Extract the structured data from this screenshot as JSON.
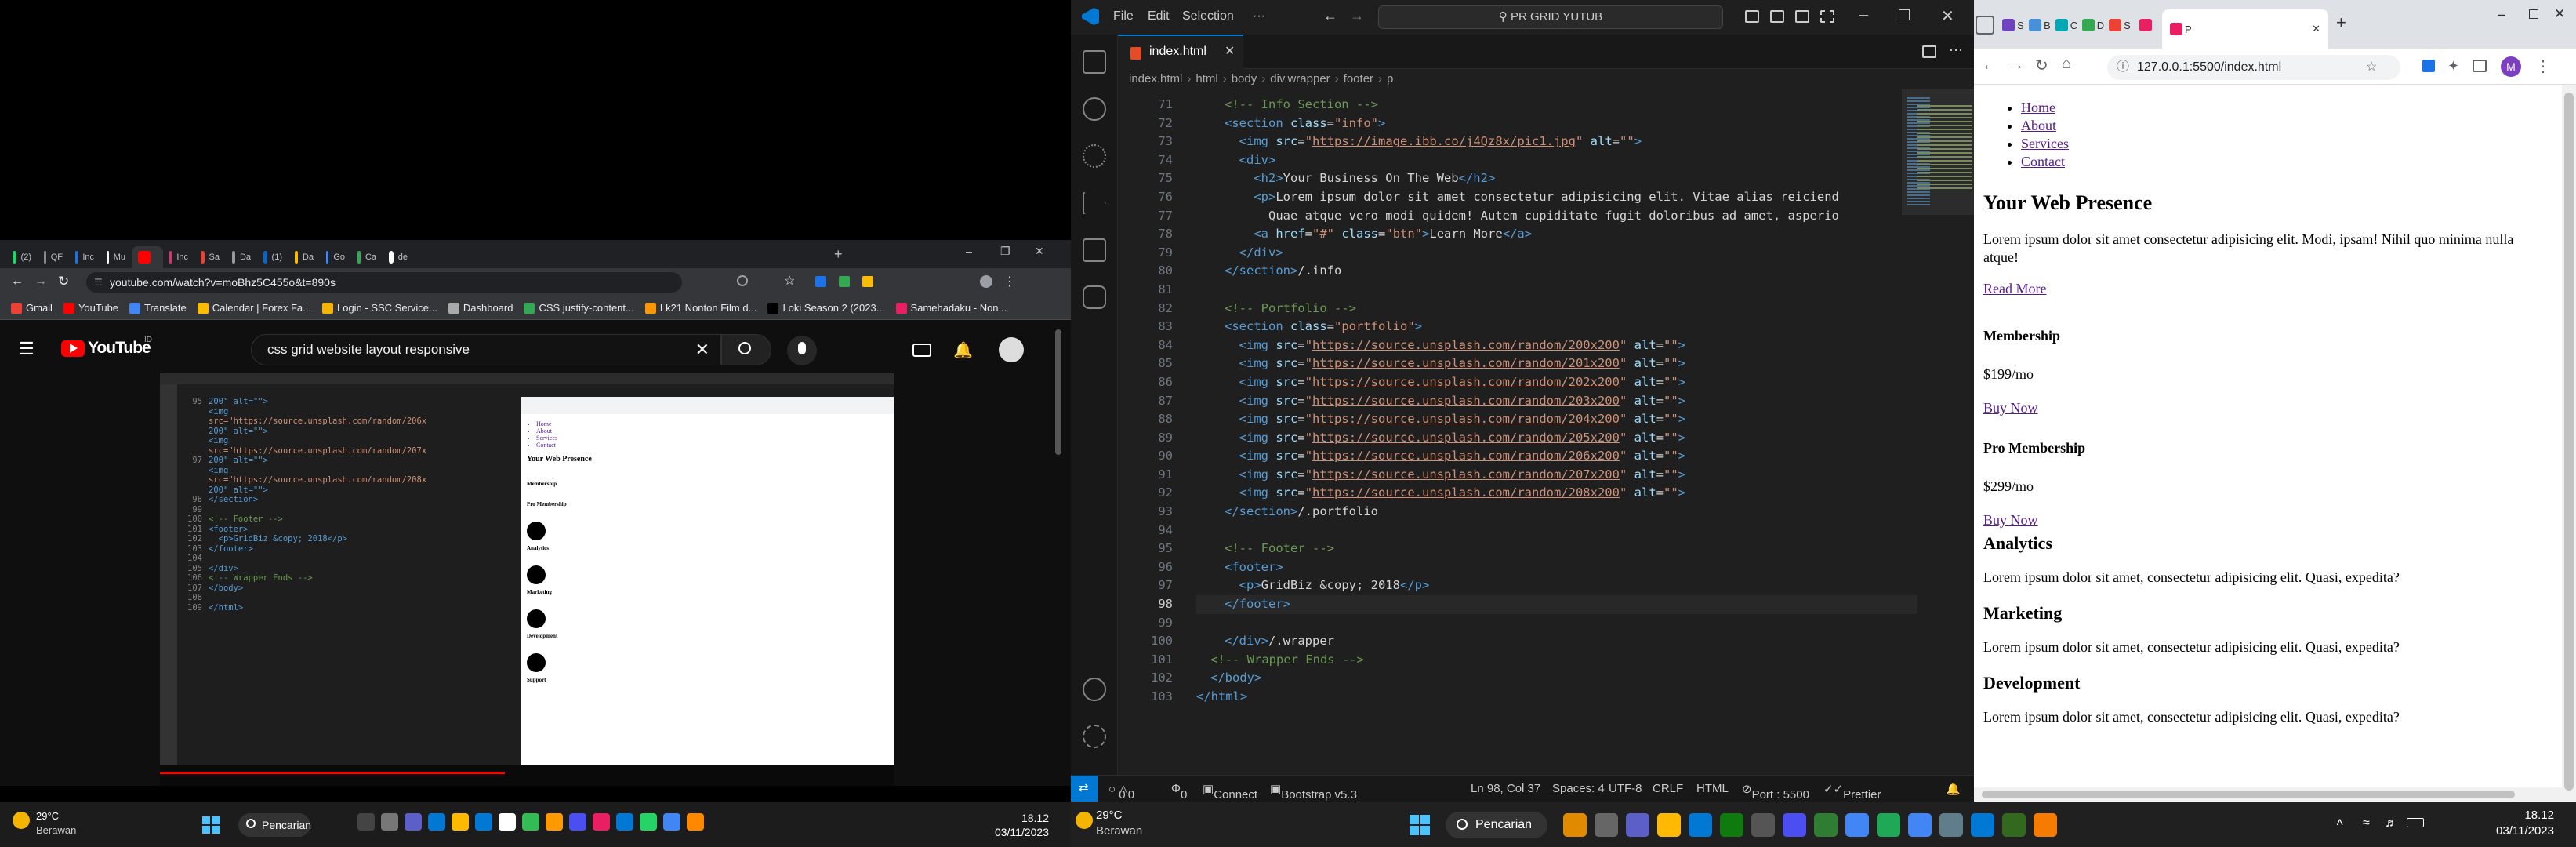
{
  "left_browser": {
    "tabs": [
      "(2)",
      "QF",
      "Inc",
      "Mu",
      "",
      "Inc",
      "Sa",
      "Da",
      "(1)",
      "Da",
      "Go",
      "Ca",
      "de"
    ],
    "url": "youtube.com/watch?v=moBhz5C455o&t=890s",
    "bookmarks": [
      "Gmail",
      "YouTube",
      "Translate",
      "Calendar | Forex Fa...",
      "Login - SSC Service...",
      "Dashboard",
      "CSS justify-content...",
      "Lk21 Nonton Film d...",
      "Loki Season 2 (2023...",
      "Samehadaku - Non..."
    ],
    "youtube": {
      "logo": "YouTube",
      "region": "ID",
      "search_value": "css grid website layout responsive"
    },
    "video": {
      "code_lines": [
        {
          "n": "95",
          "t": "200\" alt=\"\">"
        },
        {
          "n": "",
          "t": "<img"
        },
        {
          "n": "",
          "t": "src=\"https://source.unsplash.com/random/206x"
        },
        {
          "n": "",
          "t": "200\" alt=\"\">"
        },
        {
          "n": "",
          "t": "<img"
        },
        {
          "n": "",
          "t": "src=\"https://source.unsplash.com/random/207x"
        },
        {
          "n": "97",
          "t": "200\" alt=\"\">"
        },
        {
          "n": "",
          "t": "<img"
        },
        {
          "n": "",
          "t": "src=\"https://source.unsplash.com/random/208x"
        },
        {
          "n": "",
          "t": "200\" alt=\"\">"
        },
        {
          "n": "98",
          "t": "</section>"
        },
        {
          "n": "99",
          "t": ""
        },
        {
          "n": "100",
          "t": "<!-- Footer -->"
        },
        {
          "n": "101",
          "t": "<footer>"
        },
        {
          "n": "102",
          "t": "  <p>GridBiz &copy; 2018</p>"
        },
        {
          "n": "103",
          "t": "</footer>"
        },
        {
          "n": "104",
          "t": ""
        },
        {
          "n": "105",
          "t": "</div>"
        },
        {
          "n": "106",
          "t": "<!-- Wrapper Ends -->"
        },
        {
          "n": "107",
          "t": "</body>"
        },
        {
          "n": "108",
          "t": ""
        },
        {
          "n": "109",
          "t": "</html>"
        }
      ],
      "page_links": [
        "Home",
        "About",
        "Services",
        "Contact"
      ],
      "page_title": "Your Web Presence",
      "page_sections": [
        "Membership",
        "Pro Membership",
        "Analytics",
        "Marketing",
        "Development",
        "Support"
      ]
    }
  },
  "left_taskbar": {
    "weather_temp": "29°C",
    "weather_desc": "Berawan",
    "search_label": "Pencarian",
    "time": "18.12",
    "date": "03/11/2023"
  },
  "vscode": {
    "menu": [
      "File",
      "Edit",
      "Selection",
      "···"
    ],
    "command_center": "PR GRID YUTUB",
    "tab": "index.html",
    "breadcrumb": [
      "index.html",
      "html",
      "body",
      "div.wrapper",
      "footer",
      "p"
    ],
    "first_line": 71,
    "current_line": 98,
    "status": {
      "errors": "0",
      "warnings": "0",
      "ports": "0",
      "connect": "Connect",
      "bootstrap": "Bootstrap v5.3",
      "position": "Ln 98, Col 37",
      "spaces": "Spaces: 4",
      "encoding": "UTF-8",
      "eol": "CRLF",
      "language": "HTML",
      "port": "Port : 5500",
      "prettier": "Prettier"
    }
  },
  "right_browser": {
    "tabs": [
      "S",
      "B",
      "C",
      "D",
      "S",
      ""
    ],
    "active_tab": "P",
    "url": "127.0.0.1:5500/index.html",
    "profile_initial": "M",
    "nav_links": [
      "Home",
      "About",
      "Services",
      "Contact"
    ],
    "hero_title": "Your Web Presence",
    "hero_text": "Lorem ipsum dolor sit amet consectetur adipisicing elit. Modi, ipsam! Nihil quo minima nulla atque!",
    "hero_link": "Read More",
    "cards": [
      {
        "title": "Membership",
        "price": "$199/mo",
        "link": "Buy Now"
      },
      {
        "title": "Pro Membership",
        "price": "$299/mo",
        "link": "Buy Now"
      }
    ],
    "services": [
      {
        "title": "Analytics",
        "text": "Lorem ipsum dolor sit amet, consectetur adipisicing elit. Quasi, expedita?"
      },
      {
        "title": "Marketing",
        "text": "Lorem ipsum dolor sit amet, consectetur adipisicing elit. Quasi, expedita?"
      },
      {
        "title": "Development",
        "text": "Lorem ipsum dolor sit amet, consectetur adipisicing elit. Quasi, expedita?"
      }
    ]
  },
  "right_taskbar": {
    "weather_temp": "29°C",
    "weather_desc": "Berawan",
    "search_label": "Pencarian",
    "time": "18.12",
    "date": "03/11/2023"
  }
}
